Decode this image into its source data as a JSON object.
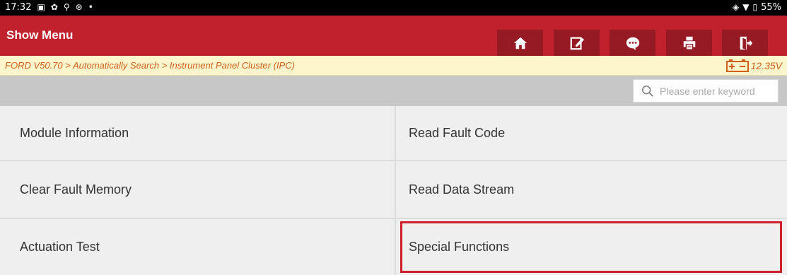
{
  "status_bar": {
    "time": "17:32",
    "battery": "55%"
  },
  "header": {
    "title": "Show Menu",
    "buttons": [
      {
        "icon": "home-icon"
      },
      {
        "icon": "edit-icon"
      },
      {
        "icon": "chat-icon"
      },
      {
        "icon": "print-icon"
      },
      {
        "icon": "exit-icon"
      }
    ]
  },
  "breadcrumb": {
    "path": "FORD V50.70 > Automatically Search > Instrument Panel Cluster (IPC)",
    "voltage": "12.35V"
  },
  "search": {
    "placeholder": "Please enter keyword",
    "value": ""
  },
  "menu": {
    "items": [
      {
        "label": "Module Information"
      },
      {
        "label": "Read Fault Code"
      },
      {
        "label": "Clear Fault Memory"
      },
      {
        "label": "Read Data Stream"
      },
      {
        "label": "Actuation Test"
      },
      {
        "label": "Special Functions",
        "highlighted": true
      }
    ]
  },
  "colors": {
    "header": "#c1202d",
    "header_button": "#951a24",
    "breadcrumb_text": "#d06018",
    "highlight": "#d01f2c"
  }
}
